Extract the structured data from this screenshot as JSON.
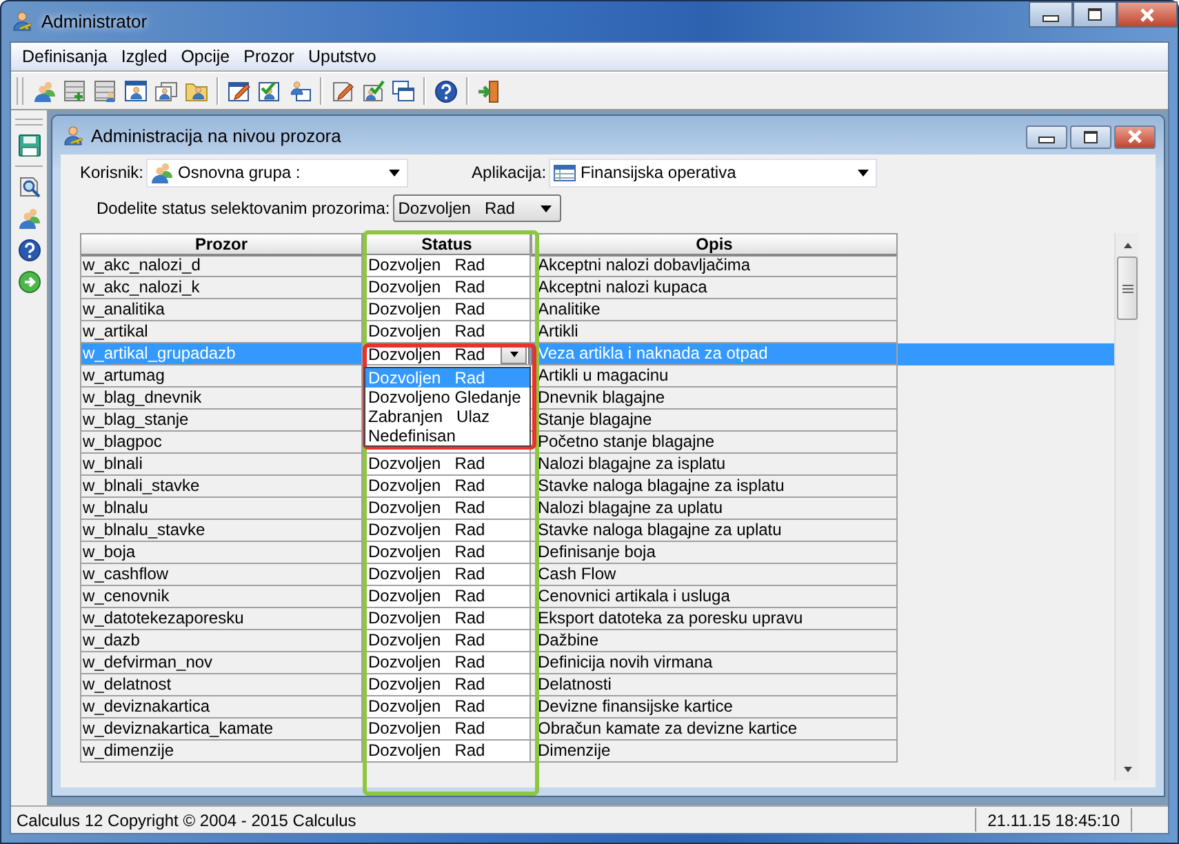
{
  "window": {
    "title": "Administrator"
  },
  "menu": [
    "Definisanja",
    "Izgled",
    "Opcije",
    "Prozor",
    "Uputstvo"
  ],
  "inner_window": {
    "title": "Administracija na nivou prozora"
  },
  "filters": {
    "user_label": "Korisnik:",
    "user_value": "Osnovna grupa :",
    "app_label": "Aplikacija:",
    "app_value": "Finansijska operativa",
    "assign_label": "Dodelite status selektovanim prozorima:",
    "assign_value": "Dozvoljen   Rad"
  },
  "table": {
    "columns": [
      "Prozor",
      "Status",
      "Opis"
    ],
    "rows": [
      {
        "prozor": "w_akc_nalozi_d",
        "status": "Dozvoljen   Rad",
        "opis": "Akceptni nalozi dobavljačima",
        "selected": false
      },
      {
        "prozor": "w_akc_nalozi_k",
        "status": "Dozvoljen   Rad",
        "opis": "Akceptni nalozi kupaca",
        "selected": false
      },
      {
        "prozor": "w_analitika",
        "status": "Dozvoljen   Rad",
        "opis": "Analitike",
        "selected": false
      },
      {
        "prozor": "w_artikal",
        "status": "Dozvoljen   Rad",
        "opis": "Artikli",
        "selected": false
      },
      {
        "prozor": "w_artikal_grupadazb",
        "status": "Dozvoljen   Rad",
        "opis": "Veza artikla i naknada za otpad",
        "selected": true
      },
      {
        "prozor": "w_artumag",
        "opis": "Artikli u magacinu",
        "selected": false
      },
      {
        "prozor": "w_blag_dnevnik",
        "opis": "Dnevnik blagajne",
        "selected": false
      },
      {
        "prozor": "w_blag_stanje",
        "opis": "Stanje blagajne",
        "selected": false
      },
      {
        "prozor": "w_blagpoc",
        "opis": "Početno stanje blagajne",
        "selected": false
      },
      {
        "prozor": "w_blnali",
        "status": "Dozvoljen   Rad",
        "opis": "Nalozi blagajne za isplatu",
        "selected": false
      },
      {
        "prozor": "w_blnali_stavke",
        "status": "Dozvoljen   Rad",
        "opis": "Stavke naloga blagajne za isplatu",
        "selected": false
      },
      {
        "prozor": "w_blnalu",
        "status": "Dozvoljen   Rad",
        "opis": "Nalozi blagajne za uplatu",
        "selected": false
      },
      {
        "prozor": "w_blnalu_stavke",
        "status": "Dozvoljen   Rad",
        "opis": "Stavke naloga blagajne za uplatu",
        "selected": false
      },
      {
        "prozor": "w_boja",
        "status": "Dozvoljen   Rad",
        "opis": "Definisanje boja",
        "selected": false
      },
      {
        "prozor": "w_cashflow",
        "status": "Dozvoljen   Rad",
        "opis": "Cash Flow",
        "selected": false
      },
      {
        "prozor": "w_cenovnik",
        "status": "Dozvoljen   Rad",
        "opis": "Cenovnici artikala i usluga",
        "selected": false
      },
      {
        "prozor": "w_datotekezaporesku",
        "status": "Dozvoljen   Rad",
        "opis": "Eksport datoteka za poresku upravu",
        "selected": false
      },
      {
        "prozor": "w_dazb",
        "status": "Dozvoljen   Rad",
        "opis": "Dažbine",
        "selected": false
      },
      {
        "prozor": "w_defvirman_nov",
        "status": "Dozvoljen   Rad",
        "opis": "Definicija novih virmana",
        "selected": false
      },
      {
        "prozor": "w_delatnost",
        "status": "Dozvoljen   Rad",
        "opis": "Delatnosti",
        "selected": false
      },
      {
        "prozor": "w_deviznakartica",
        "status": "Dozvoljen   Rad",
        "opis": "Devizne finansijske kartice",
        "selected": false
      },
      {
        "prozor": "w_deviznakartica_kamate",
        "status": "Dozvoljen   Rad",
        "opis": "Obračun kamate za devizne kartice",
        "selected": false
      },
      {
        "prozor": "w_dimenzije",
        "status": "Dozvoljen   Rad",
        "opis": "Dimenzije",
        "selected": false
      }
    ]
  },
  "status_dropdown": {
    "options": [
      {
        "label": "Dozvoljen   Rad",
        "selected": true
      },
      {
        "label": "Dozvoljeno Gledanje",
        "selected": false
      },
      {
        "label": "Zabranjen   Ulaz",
        "selected": false
      },
      {
        "label": "Nedefinisan",
        "selected": false
      }
    ]
  },
  "highlights": [
    {
      "kind": "column",
      "color": "#8dc63f"
    },
    {
      "kind": "dropdown",
      "color": "#e8322b"
    }
  ],
  "status_bar": {
    "left": "Calculus 12  Copyright © 2004 - 2015  Calculus",
    "right": "21.11.15 18:45:10"
  }
}
